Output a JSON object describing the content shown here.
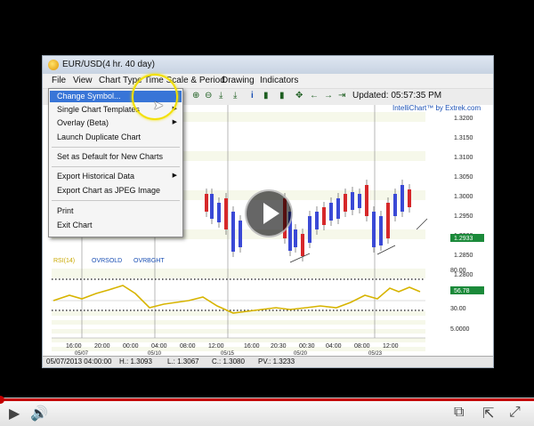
{
  "window": {
    "title": "EUR/USD(4 hr. 40 day)",
    "menus": [
      "File",
      "View",
      "Chart Type",
      "Time Scale & Period",
      "Drawing",
      "Indicators"
    ],
    "updated": "Updated: 05:57:35 PM"
  },
  "file_menu": {
    "items": [
      {
        "label": "Change Symbol...",
        "highlighted": true
      },
      {
        "label": "Single Chart Templates",
        "submenu": true
      },
      {
        "label": "Overlay (Beta)",
        "submenu": true
      },
      {
        "label": "Launch Duplicate Chart"
      },
      {
        "label": "Set as Default for New Charts"
      },
      {
        "label": "Export Historical Data",
        "submenu": true
      },
      {
        "label": "Export Chart as JPEG Image"
      },
      {
        "label": "Print"
      },
      {
        "label": "Exit Chart"
      }
    ]
  },
  "chart": {
    "brand": "IntelliChart™ by Extrek.com",
    "price_ticks": [
      "1.3200",
      "1.3150",
      "1.3100",
      "1.3050",
      "1.3000",
      "1.2950",
      "1.2900",
      "1.2850",
      "1.2800"
    ],
    "last_price": "1.2933",
    "rsi_ticks": [
      "80.00",
      "30.00",
      "5.0000"
    ],
    "rsi_value": "56.78",
    "indicator_legend": {
      "rsi": "RSI(14)",
      "oversold": "OVRSOLD",
      "overbought": "OVRBGHT"
    },
    "time_ticks": [
      "16:00",
      "20:00",
      "00:00",
      "04:00",
      "08:00",
      "12:00",
      "16:00",
      "20:30",
      "00:30",
      "04:00",
      "08:00",
      "12:00"
    ],
    "date_ticks": [
      "05/07",
      "05/10",
      "05/15",
      "05/20",
      "05/23"
    ],
    "info": {
      "date": "05/07/2013 04:00:00",
      "high": "H.: 1.3093",
      "low": "L.: 1.3067",
      "close": "C.: 1.3080",
      "pv": "PV.: 1.3233"
    }
  },
  "colors": {
    "up_candle": "#3a49d6",
    "down_candle": "#d6282a",
    "rsi_line": "#d7b400",
    "accent_menu": "#3875d7"
  },
  "icons": {
    "play": "play-icon",
    "volume": "volume-icon",
    "captions": "captions-icon",
    "share": "share-icon",
    "fullscreen": "fullscreen-icon"
  }
}
